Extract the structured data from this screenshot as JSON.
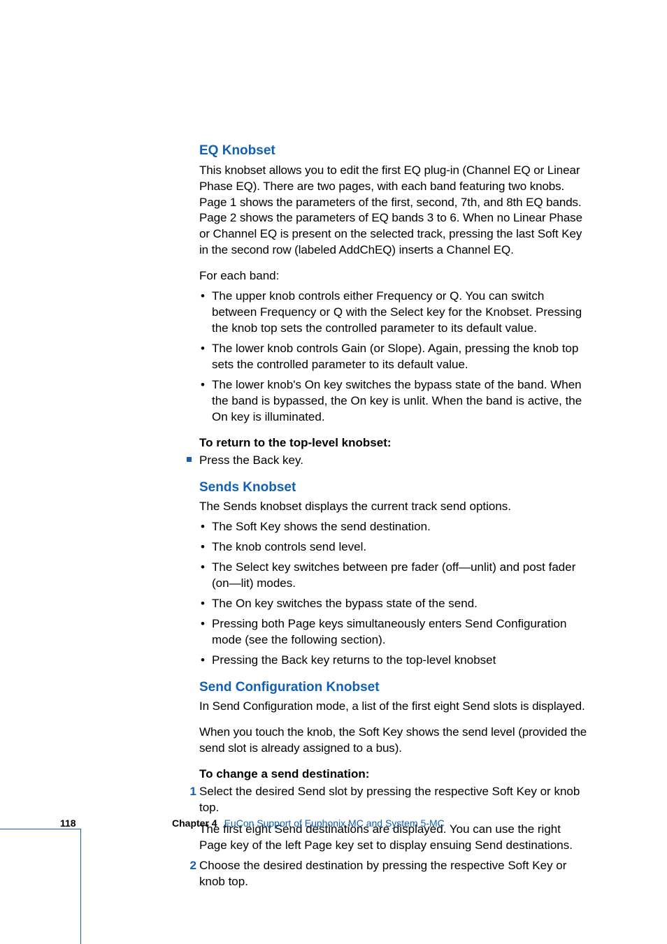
{
  "section1": {
    "heading": "EQ Knobset",
    "para1": "This knobset allows you to edit the first EQ plug-in (Channel EQ or Linear Phase EQ). There are two pages, with each band featuring two knobs. Page 1 shows the parameters of the first, second, 7th, and 8th EQ bands. Page 2 shows the parameters of EQ bands 3 to 6. When no Linear Phase or Channel EQ is present on the selected track, pressing the last Soft Key in the second row (labeled AddChEQ) inserts a Channel EQ.",
    "lead": "For each band:",
    "bullets": [
      "The upper knob controls either Frequency or Q. You can switch between Frequency or Q with the Select key for the Knobset. Pressing the knob top sets the controlled parameter to its default value.",
      "The lower knob controls Gain (or Slope). Again, pressing the knob top sets the controlled parameter to its default value.",
      "The lower knob's On key switches the bypass state of the band. When the band is bypassed, the On key is unlit. When the band is active, the On key is illuminated."
    ],
    "instr": "To return to the top-level knobset:",
    "step": "Press the Back key."
  },
  "section2": {
    "heading": "Sends Knobset",
    "para1": "The Sends knobset displays the current track send options.",
    "bullets": [
      "The Soft Key shows the send destination.",
      "The knob controls send level.",
      "The Select key switches between pre fader (off—unlit) and post fader (on—lit) modes.",
      "The On key switches the bypass state of the send.",
      "Pressing both Page keys simultaneously enters Send Configuration mode (see the following section).",
      "Pressing the Back key returns to the top-level knobset"
    ]
  },
  "section3": {
    "heading": "Send Configuration Knobset",
    "para1": "In Send Configuration mode, a list of the first eight Send slots is displayed.",
    "para2": "When you touch the knob, the Soft Key shows the send level (provided the send slot is already assigned to a bus).",
    "instr": "To change a send destination:",
    "steps": [
      {
        "num": "1",
        "text": "Select the desired Send slot by pressing the respective Soft Key or knob top.",
        "sub": "The first eight Send destinations are displayed. You can use the right Page key of the left Page key set to display ensuing Send destinations."
      },
      {
        "num": "2",
        "text": "Choose the desired destination by pressing the respective Soft Key or knob top."
      }
    ]
  },
  "footer": {
    "page": "118",
    "chapter_label": "Chapter 4",
    "chapter_title": "EuCon Support of Euphonix MC and System 5-MC"
  }
}
